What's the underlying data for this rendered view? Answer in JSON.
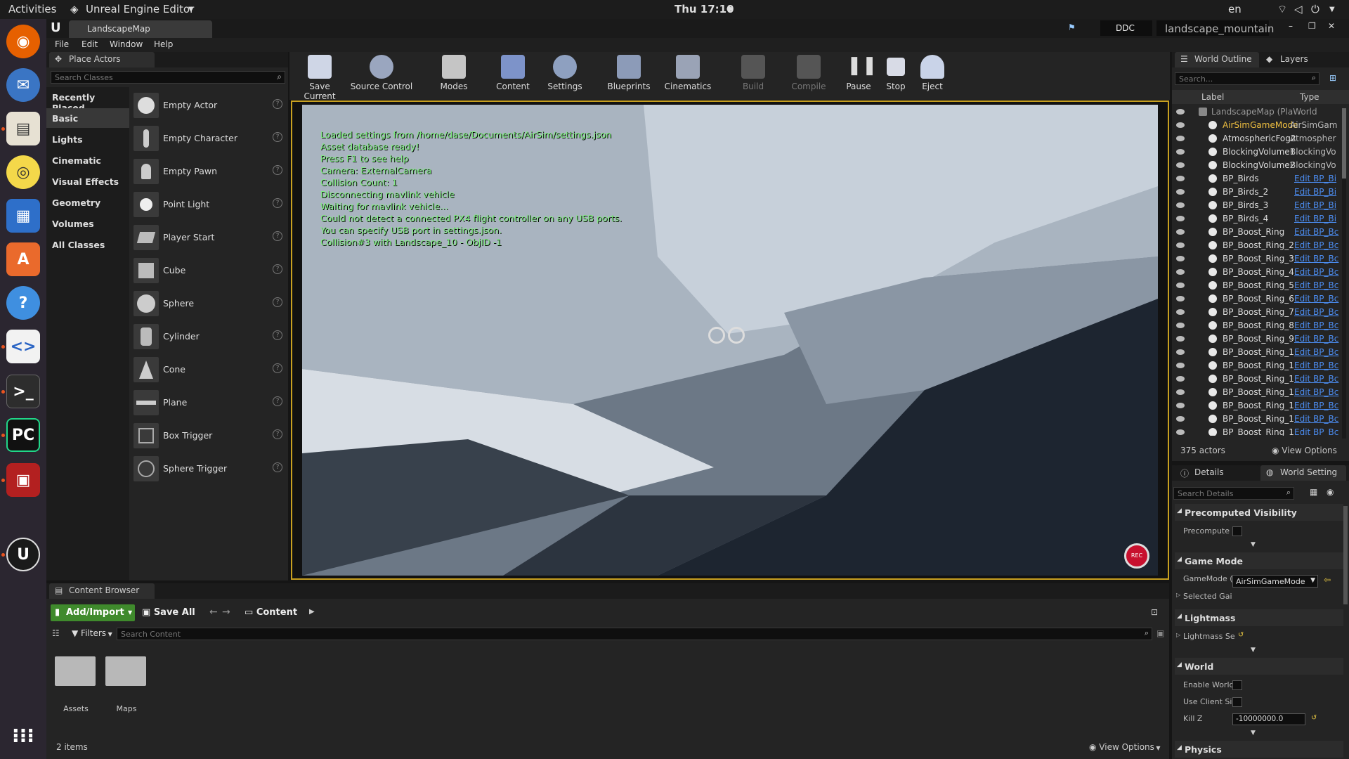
{
  "system_bar": {
    "activities": "Activities",
    "app_menu": "Unreal Engine Editor",
    "clock": "Thu 17:10",
    "lang": "en"
  },
  "window": {
    "tab_title": "LandscapeMap",
    "ddc": "DDC",
    "project": "landscape_mountain"
  },
  "menu": [
    "File",
    "Edit",
    "Window",
    "Help"
  ],
  "place_actors": {
    "tab": "Place Actors",
    "search_placeholder": "Search Classes",
    "categories": [
      "Recently Placed",
      "Basic",
      "Lights",
      "Cinematic",
      "Visual Effects",
      "Geometry",
      "Volumes",
      "All Classes"
    ],
    "actors": [
      "Empty Actor",
      "Empty Character",
      "Empty Pawn",
      "Point Light",
      "Player Start",
      "Cube",
      "Sphere",
      "Cylinder",
      "Cone",
      "Plane",
      "Box Trigger",
      "Sphere Trigger"
    ]
  },
  "toolbar": [
    "Save Current",
    "Source Control",
    "Modes",
    "Content",
    "Settings",
    "Blueprints",
    "Cinematics",
    "Build",
    "Compile",
    "Pause",
    "Stop",
    "Eject"
  ],
  "viewport": {
    "messages": [
      "Loaded settings from /home/dase/Documents/AirSim/settings.json",
      "Asset database ready!",
      "Press F1 to see help",
      "Camera: ExternalCamera",
      "Collision Count: 1",
      "Disconnecting mavlink vehicle",
      "Waiting for mavlink vehicle...",
      "Could not detect a connected PX4 flight controller on any USB ports.",
      "You can specify USB port in settings.json.",
      "Collision#3 with Landscape_10 - ObjID -1"
    ],
    "rec": "REC"
  },
  "world_outliner": {
    "tabs": [
      "World Outline",
      "Layers"
    ],
    "search_placeholder": "Search...",
    "col_label": "Label",
    "col_type": "Type",
    "rows": [
      {
        "name": "LandscapeMap (PlaWorld",
        "type": ""
      },
      {
        "name": "AirSimGameMode",
        "type": "AirSimGam"
      },
      {
        "name": "AtmosphericFog2",
        "type": "Atmospher"
      },
      {
        "name": "BlockingVolume1",
        "type": "BlockingVo"
      },
      {
        "name": "BlockingVolume2",
        "type": "BlockingVo"
      },
      {
        "name": "BP_Birds",
        "type": "Edit BP_Bi"
      },
      {
        "name": "BP_Birds_2",
        "type": "Edit BP_Bi"
      },
      {
        "name": "BP_Birds_3",
        "type": "Edit BP_Bi"
      },
      {
        "name": "BP_Birds_4",
        "type": "Edit BP_Bi"
      },
      {
        "name": "BP_Boost_Ring",
        "type": "Edit BP_Bc"
      },
      {
        "name": "BP_Boost_Ring_2",
        "type": "Edit BP_Bc"
      },
      {
        "name": "BP_Boost_Ring_3",
        "type": "Edit BP_Bc"
      },
      {
        "name": "BP_Boost_Ring_4",
        "type": "Edit BP_Bc"
      },
      {
        "name": "BP_Boost_Ring_5",
        "type": "Edit BP_Bc"
      },
      {
        "name": "BP_Boost_Ring_6",
        "type": "Edit BP_Bc"
      },
      {
        "name": "BP_Boost_Ring_7",
        "type": "Edit BP_Bc"
      },
      {
        "name": "BP_Boost_Ring_8",
        "type": "Edit BP_Bc"
      },
      {
        "name": "BP_Boost_Ring_9",
        "type": "Edit BP_Bc"
      },
      {
        "name": "BP_Boost_Ring_1",
        "type": "Edit BP_Bc"
      },
      {
        "name": "BP_Boost_Ring_1",
        "type": "Edit BP_Bc"
      },
      {
        "name": "BP_Boost_Ring_1",
        "type": "Edit BP_Bc"
      },
      {
        "name": "BP_Boost_Ring_1",
        "type": "Edit BP_Bc"
      },
      {
        "name": "BP_Boost_Ring_1",
        "type": "Edit BP_Bc"
      },
      {
        "name": "BP_Boost_Ring_1",
        "type": "Edit BP_Bc"
      },
      {
        "name": "BP_Boost_Ring_1",
        "type": "Edit BP_Bc"
      }
    ],
    "count": "375 actors",
    "view_options": "View Options"
  },
  "details": {
    "tabs": [
      "Details",
      "World Setting"
    ],
    "search_placeholder": "Search Details",
    "sections": {
      "precomputed": "Precomputed Visibility",
      "precompute_prop": "Precompute '",
      "game_mode": "Game Mode",
      "game_mode_prop": "GameMode (",
      "game_mode_value": "AirSimGameMode",
      "selected": "Selected Gai",
      "lightmass": "Lightmass",
      "lightmass_prop": "Lightmass Se",
      "world": "World",
      "enable_world": "Enable World",
      "use_client": "Use Client Si",
      "kill_z": "Kill Z",
      "kill_z_value": "-10000000.0",
      "physics": "Physics"
    }
  },
  "content_browser": {
    "tab": "Content Browser",
    "add_import": "Add/Import",
    "save_all": "Save All",
    "path": "Content",
    "filters": "Filters",
    "search_placeholder": "Search Content",
    "folders": [
      "Assets",
      "Maps"
    ],
    "items": "2 items",
    "view_options": "View Options"
  }
}
